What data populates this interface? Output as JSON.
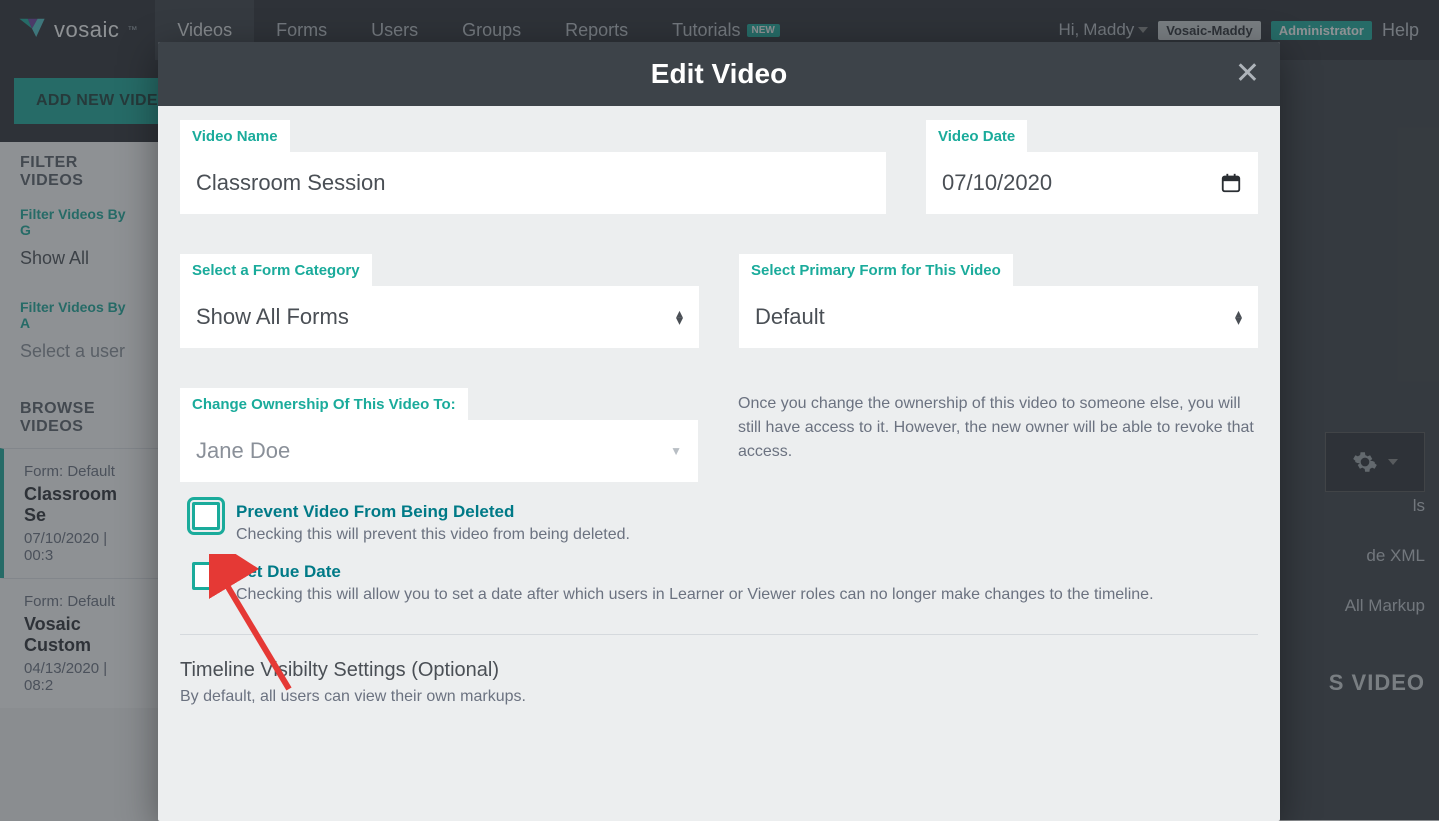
{
  "nav": {
    "brand": "vosaic",
    "items": [
      "Videos",
      "Forms",
      "Users",
      "Groups",
      "Reports",
      "Tutorials"
    ],
    "new_badge": "NEW",
    "greeting_prefix": "Hi, ",
    "greeting_name": "Maddy",
    "user_badge": "Vosaic-Maddy",
    "role_badge": "Administrator",
    "help": "Help"
  },
  "toolbar": {
    "add_button": "ADD NEW VIDEO"
  },
  "sidebar": {
    "filter_title": "FILTER VIDEOS",
    "filter_group_label": "Filter Videos By G",
    "filter_group_value": "Show All",
    "filter_user_label": "Filter Videos By A",
    "filter_user_placeholder": "Select a user",
    "browse_title": "BROWSE VIDEOS",
    "videos": [
      {
        "form": "Form: Default",
        "title": "Classroom Se",
        "meta": "07/10/2020 | 00:3"
      },
      {
        "form": "Form: Default",
        "title": "Vosaic Custom",
        "meta": "04/13/2020 | 08:2"
      }
    ]
  },
  "right": {
    "menu1": "ls",
    "menu2": "de XML",
    "menu3": "All Markup",
    "big": "S VIDEO"
  },
  "modal": {
    "title": "Edit Video",
    "video_name_label": "Video Name",
    "video_name_value": "Classroom Session",
    "video_date_label": "Video Date",
    "video_date_value": "07/10/2020",
    "form_category_label": "Select a Form Category",
    "form_category_value": "Show All Forms",
    "primary_form_label": "Select Primary Form for This Video",
    "primary_form_value": "Default",
    "ownership_label": "Change Ownership Of This Video To:",
    "ownership_value": "Jane Doe",
    "ownership_help": "Once you change the ownership of this video to someone else, you will still have access to it. However, the new owner will be able to revoke that access.",
    "prevent_delete_title": "Prevent Video From Being Deleted",
    "prevent_delete_desc": "Checking this will prevent this video from being deleted.",
    "due_date_title": "Set Due Date",
    "due_date_desc": "Checking this will allow you to set a date after which users in Learner or Viewer roles can no longer make changes to the timeline.",
    "timeline_title": "Timeline Visibilty Settings (Optional)",
    "timeline_sub": "By default, all users can view their own markups."
  }
}
